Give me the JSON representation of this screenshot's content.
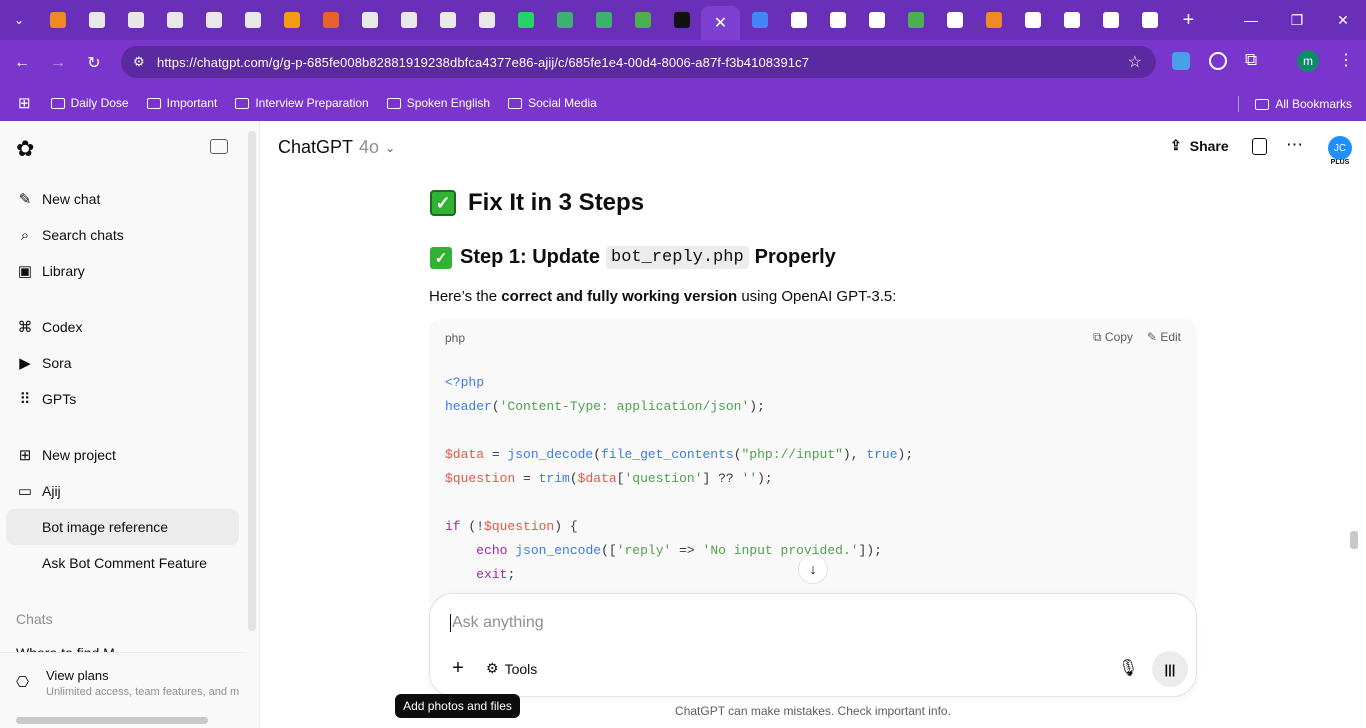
{
  "browser": {
    "url": "https://chatgpt.com/g/g-p-685fe008b82881919238dbfca4377e86-ajij/c/685fe1e4-00d4-8006-a87f-f3b4108391c7",
    "tab_colors": [
      "#f08a24",
      "#e8e8e8",
      "#e8e8e8",
      "#e8e8e8",
      "#e8e8e8",
      "#e8e8e8",
      "#f39c12",
      "#e8632b",
      "#e8e8e8",
      "#e8e8e8",
      "#e8e8e8",
      "#e8e8e8",
      "#25d366",
      "#3bb36f",
      "#3bb36f",
      "#4caf50",
      "#111111",
      "#ffffff",
      "#4285f4",
      "#ffffff",
      "#ffffff",
      "#ffffff",
      "#4caf50",
      "#ffffff",
      "#f08a24",
      "#ffffff",
      "#ffffff",
      "#ffffff",
      "#ffffff"
    ],
    "bookmarks": [
      "Daily Dose",
      "Important",
      "Interview Preparation",
      "Spoken English",
      "Social Media"
    ],
    "all_bookmarks": "All Bookmarks",
    "profile_initial": "m"
  },
  "sidebar": {
    "items": [
      {
        "label": "New chat",
        "icon": "new-chat-icon"
      },
      {
        "label": "Search chats",
        "icon": "search-icon"
      },
      {
        "label": "Library",
        "icon": "library-icon"
      },
      {
        "label": "Codex",
        "icon": "codex-icon"
      },
      {
        "label": "Sora",
        "icon": "sora-icon"
      },
      {
        "label": "GPTs",
        "icon": "gpts-icon"
      },
      {
        "label": "New project",
        "icon": "folder-plus-icon"
      },
      {
        "label": "Ajij",
        "icon": "folder-icon"
      },
      {
        "label": "Bot image reference"
      },
      {
        "label": "Ask Bot Comment Feature"
      }
    ],
    "chats_heading": "Chats",
    "partial_chat": "Where to find M",
    "plans_title": "View plans",
    "plans_sub": "Unlimited access, team features, and m"
  },
  "header": {
    "model": "ChatGPT",
    "model_variant": "4o",
    "share": "Share",
    "avatar": "JC",
    "plus": "PLUS"
  },
  "content": {
    "h1": "Fix It in 3 Steps",
    "h2_pre": "Step 1: Update",
    "h2_code": "bot_reply.php",
    "h2_post": "Properly",
    "para_pre": "Here’s the ",
    "para_bold": "correct and fully working version",
    "para_post": " using OpenAI GPT-3.5:",
    "code_lang": "php",
    "copy": "Copy",
    "edit": "Edit"
  },
  "composer": {
    "placeholder": "Ask anything",
    "tools": "Tools",
    "tooltip": "Add photos and files"
  },
  "footer": {
    "disclaimer": "ChatGPT can make mistakes. Check important info."
  }
}
